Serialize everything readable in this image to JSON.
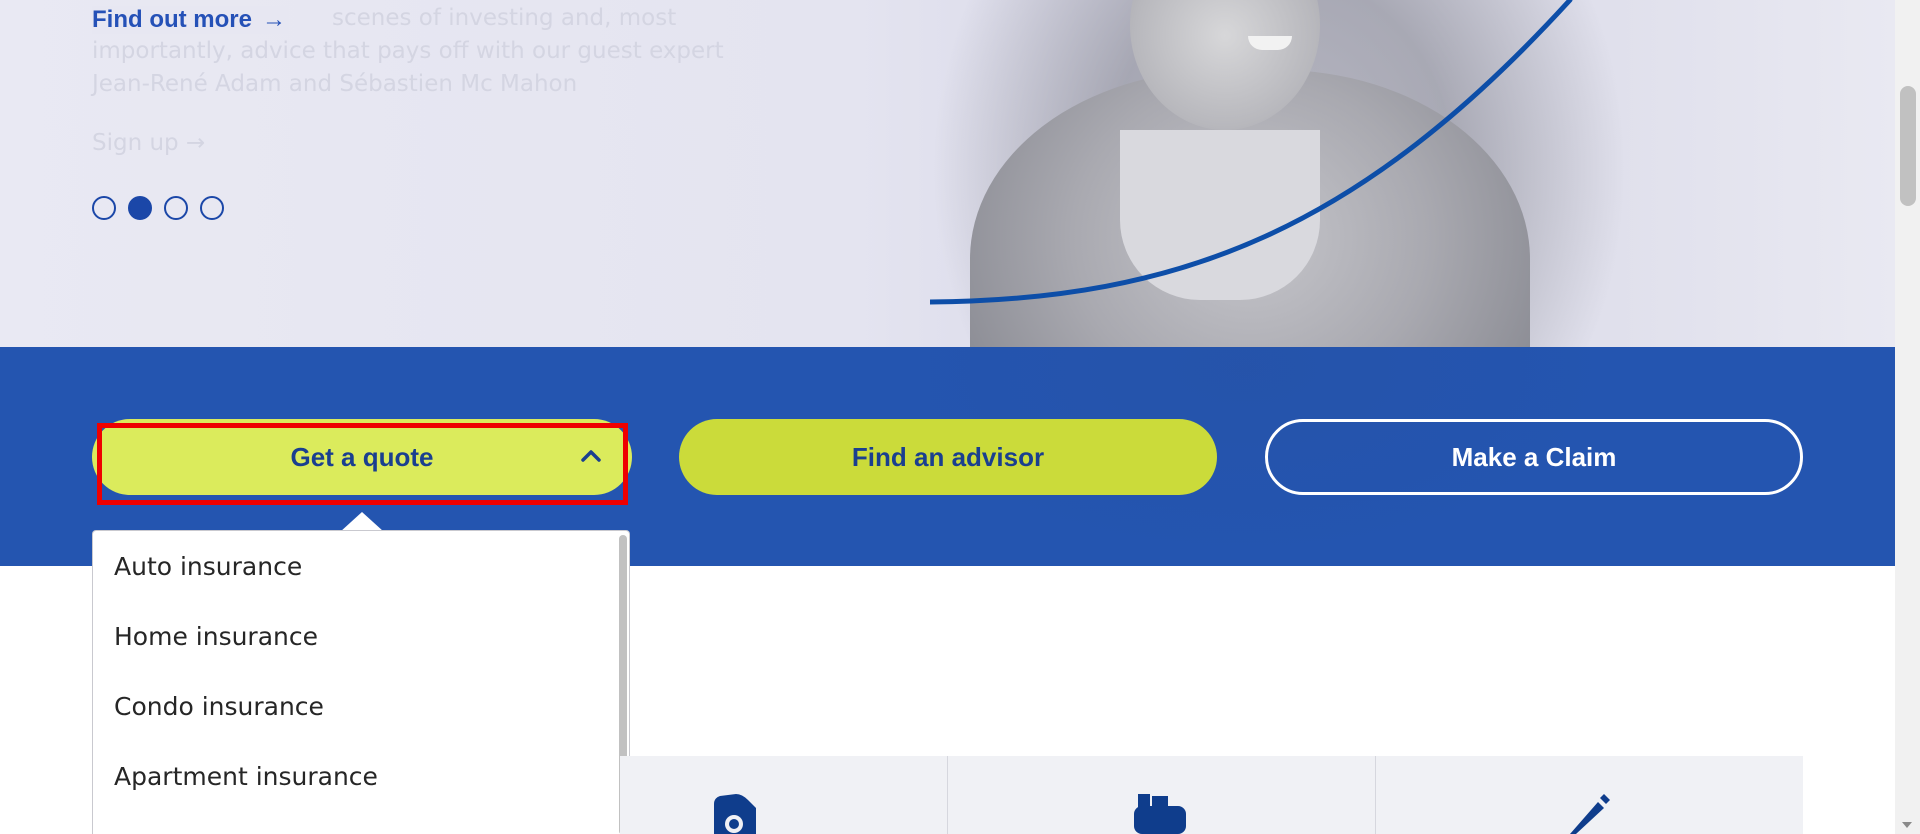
{
  "hero": {
    "find_more": "Find out more",
    "faded_line1": "scenes of investing and, most",
    "faded_line2": "importantly, advice that pays off with our guest expert",
    "faded_line3": "Jean-René Adam and Sébastien Mc Mahon",
    "signup": "Sign up →",
    "carousel": {
      "total": 4,
      "active_index": 1
    }
  },
  "actions": {
    "quote": "Get a quote",
    "advisor": "Find an advisor",
    "claim": "Make a Claim"
  },
  "dropdown": {
    "items": [
      "Auto insurance",
      "Home insurance",
      "Condo insurance",
      "Apartment insurance"
    ]
  },
  "icons": {
    "find_more_arrow": "arrow-right-icon",
    "quote_chevron": "chevron-up-icon",
    "card_icons": [
      "tag-search-icon",
      "mailbox-icon",
      "pencil-icon"
    ]
  },
  "colors": {
    "band_blue": "#2455b0",
    "lime": "#dbeb5c",
    "lime_dark": "#cbdb3a",
    "text_blue": "#1a3f8f",
    "highlight_red": "#ee0000"
  }
}
